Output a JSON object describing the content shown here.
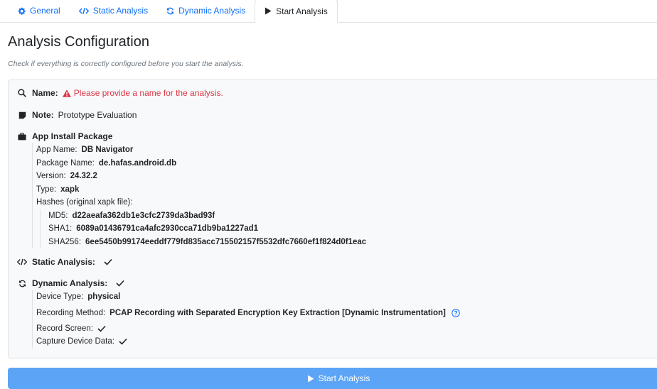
{
  "tabs": [
    {
      "label": "General",
      "icon": "gear-icon"
    },
    {
      "label": "Static Analysis",
      "icon": "code-icon"
    },
    {
      "label": "Dynamic Analysis",
      "icon": "sync-icon"
    },
    {
      "label": "Start Analysis",
      "icon": "play-icon"
    }
  ],
  "page": {
    "title": "Analysis Configuration",
    "subtitle": "Check if everything is correctly configured before you start the analysis."
  },
  "name": {
    "label": "Name:",
    "error": "Please provide a name for the analysis."
  },
  "note": {
    "label": "Note:",
    "value": "Prototype Evaluation"
  },
  "package": {
    "label": "App Install Package",
    "app_name_label": "App Name:",
    "app_name": "DB Navigator",
    "package_name_label": "Package Name:",
    "package_name": "de.hafas.android.db",
    "version_label": "Version:",
    "version": "24.32.2",
    "type_label": "Type:",
    "type": "xapk",
    "hashes_label": "Hashes (original xapk file):",
    "md5_label": "MD5:",
    "md5": "d22aeafa362db1e3cfc2739da3bad93f",
    "sha1_label": "SHA1:",
    "sha1": "6089a01436791ca4afc2930cca71db9ba1227ad1",
    "sha256_label": "SHA256:",
    "sha256": "6ee5450b99174eeddf779fd835acc715502157f5532dfc7660ef1f824d0f1eac"
  },
  "static": {
    "label": "Static Analysis:"
  },
  "dynamic": {
    "label": "Dynamic Analysis:",
    "device_type_label": "Device Type:",
    "device_type": "physical",
    "recording_label": "Recording Method:",
    "recording": "PCAP Recording with Separated Encryption Key Extraction [Dynamic Instrumentation]",
    "record_screen_label": "Record Screen:",
    "capture_label": "Capture Device Data:"
  },
  "start_button": "Start Analysis",
  "colors": {
    "link": "#0d6efd",
    "danger": "#dc3545",
    "button": "#5ba4f6"
  }
}
